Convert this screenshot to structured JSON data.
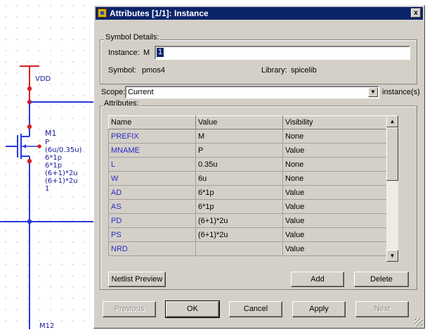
{
  "schematic": {
    "vdd_label": "VDD",
    "component": {
      "name": "M1",
      "lines": [
        "P",
        "(6u/0.35u)",
        "6*1p",
        "6*1p",
        "(6+1)*2u",
        "(6+1)*2u",
        "1"
      ]
    },
    "bottom_label": "M12"
  },
  "dialog": {
    "title": "Attributes [1/1]: Instance",
    "close_symbol": "x",
    "symbol_details": {
      "legend": "Symbol Details:",
      "instance_label": "Instance:",
      "instance_prefix": "M",
      "instance_value": "1",
      "symbol_label": "Symbol:",
      "symbol_value": "pmos4",
      "library_label": "Library:",
      "library_value": "spicelib"
    },
    "scope": {
      "label": "Scope:",
      "value": "Current",
      "suffix": "instance(s)"
    },
    "attributes": {
      "legend": "Attributes:",
      "columns": [
        "Name",
        "Value",
        "Visibility"
      ],
      "rows": [
        [
          "PREFIX",
          "M",
          "None"
        ],
        [
          "MNAME",
          "P",
          "Value"
        ],
        [
          "L",
          "0.35u",
          "None"
        ],
        [
          "W",
          "6u",
          "None"
        ],
        [
          "AD",
          "6*1p",
          "Value"
        ],
        [
          "AS",
          "6*1p",
          "Value"
        ],
        [
          "PD",
          "(6+1)*2u",
          "Value"
        ],
        [
          "PS",
          "(6+1)*2u",
          "Value"
        ],
        [
          "NRD",
          "",
          "Value"
        ]
      ]
    },
    "buttons": {
      "netlist_preview": "Netlist Preview",
      "add": "Add",
      "delete": "Delete",
      "previous": "Previous",
      "ok": "OK",
      "cancel": "Cancel",
      "apply": "Apply",
      "next": "Next"
    }
  },
  "colors": {
    "titlebar": "#0a246a",
    "dialog_face": "#d4d0c8",
    "attr_name_text": "#2828c8",
    "wire_blue": "#2838d8",
    "wire_red": "#d82020"
  }
}
